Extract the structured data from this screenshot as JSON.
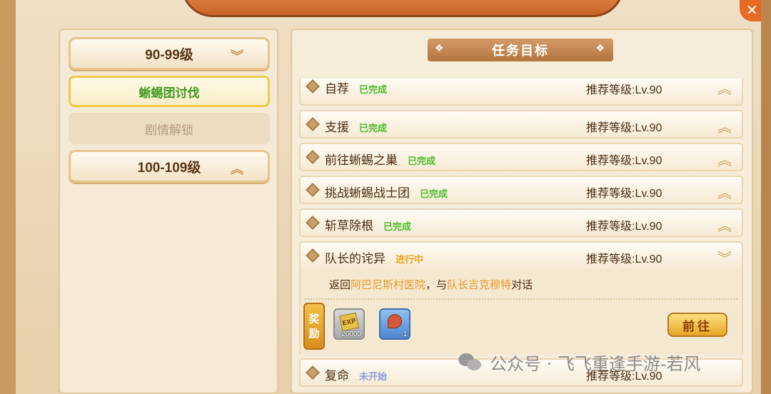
{
  "level_groups": [
    {
      "label": "90-99级",
      "expanded": true
    },
    {
      "label": "100-109级",
      "expanded": false
    }
  ],
  "chapters": [
    {
      "label": "蜥蜴团讨伐",
      "state": "active"
    },
    {
      "label": "剧情解锁",
      "state": "locked"
    }
  ],
  "section_title": "任务目标",
  "tasks": [
    {
      "name": "自荐",
      "status": "已完成",
      "status_type": "done",
      "recommend": "推荐等级:Lv.90"
    },
    {
      "name": "支援",
      "status": "已完成",
      "status_type": "done",
      "recommend": "推荐等级:Lv.90"
    },
    {
      "name": "前往蜥蜴之巢",
      "status": "已完成",
      "status_type": "done",
      "recommend": "推荐等级:Lv.90"
    },
    {
      "name": "挑战蜥蜴战士团",
      "status": "已完成",
      "status_type": "done",
      "recommend": "推荐等级:Lv.90"
    },
    {
      "name": "斩草除根",
      "status": "已完成",
      "status_type": "done",
      "recommend": "推荐等级:Lv.90"
    },
    {
      "name": "队长的诧异",
      "status": "进行中",
      "status_type": "progress",
      "recommend": "推荐等级:Lv.90"
    },
    {
      "name": "复命",
      "status": "未开始",
      "status_type": "notstarted",
      "recommend": "推荐等级:Lv.90"
    }
  ],
  "detail": {
    "prefix": "返回",
    "place": "阿巴尼斯村医院",
    "middle": "，与",
    "npc": "队长吉克穆特",
    "suffix": "对话"
  },
  "reward": {
    "label_top": "奖",
    "label_bottom": "励",
    "items": [
      {
        "icon": "exp-ticket-icon",
        "badge": "EXP",
        "qty": "20000"
      },
      {
        "icon": "meat-icon",
        "qty": "1"
      }
    ]
  },
  "go_button": "前往",
  "watermark": "公众号 · 飞飞重逢手游-若风",
  "colors": {
    "done": "#4cbd2b",
    "progress": "#f2a21e",
    "notstarted": "#8c9be0",
    "highlight": "#e69a2a"
  }
}
